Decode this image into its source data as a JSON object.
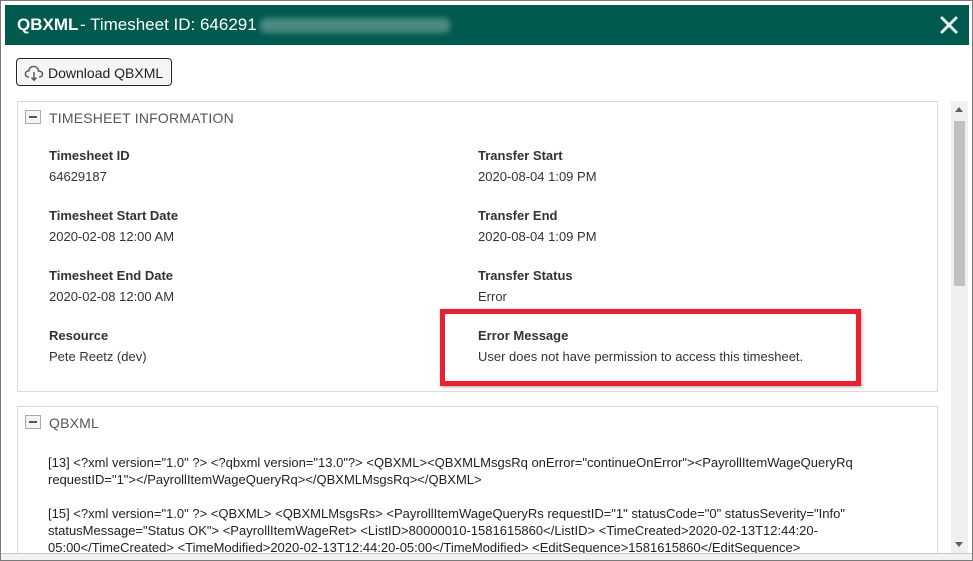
{
  "dialog": {
    "title_strong": "QBXML",
    "title_rest": "- Timesheet ID: 646291",
    "close_glyph": "×"
  },
  "toolbar": {
    "download_label": "Download QBXML",
    "download_icon": "cloud-download-icon"
  },
  "timesheet_info": {
    "title": "TIMESHEET INFORMATION",
    "fields": [
      {
        "label": "Timesheet ID",
        "value": "64629187"
      },
      {
        "label": "Transfer Start",
        "value": "2020-08-04 1:09 PM"
      },
      {
        "label": "Timesheet Start Date",
        "value": "2020-02-08 12:00 AM"
      },
      {
        "label": "Transfer End",
        "value": "2020-08-04 1:09 PM"
      },
      {
        "label": "Timesheet End Date",
        "value": "2020-02-08 12:00 AM"
      },
      {
        "label": "Transfer Status",
        "value": "Error"
      },
      {
        "label": "Resource",
        "value": "Pete Reetz (dev)"
      },
      {
        "label": "Error Message",
        "value": "User does not have permission to access this timesheet."
      }
    ]
  },
  "qbxml": {
    "title": "QBXML",
    "entries": [
      "[13] <?xml version=\"1.0\" ?> <?qbxml version=\"13.0\"?> <QBXML><QBXMLMsgsRq onError=\"continueOnError\"><PayrollItemWageQueryRq\nrequestID=\"1\"></PayrollItemWageQueryRq></QBXMLMsgsRq></QBXML>",
      "[15] <?xml version=\"1.0\" ?> <QBXML> <QBXMLMsgsRs> <PayrollItemWageQueryRs requestID=\"1\" statusCode=\"0\" statusSeverity=\"Info\"\nstatusMessage=\"Status OK\"> <PayrollItemWageRet> <ListID>80000010-1581615860</ListID> <TimeCreated>2020-02-13T12:44:20-\n05:00</TimeCreated> <TimeModified>2020-02-13T12:44:20-05:00</TimeModified> <EditSequence>1581615860</EditSequence>"
    ]
  },
  "colors": {
    "titlebar": "#005a4e",
    "highlight": "#e8202f"
  }
}
